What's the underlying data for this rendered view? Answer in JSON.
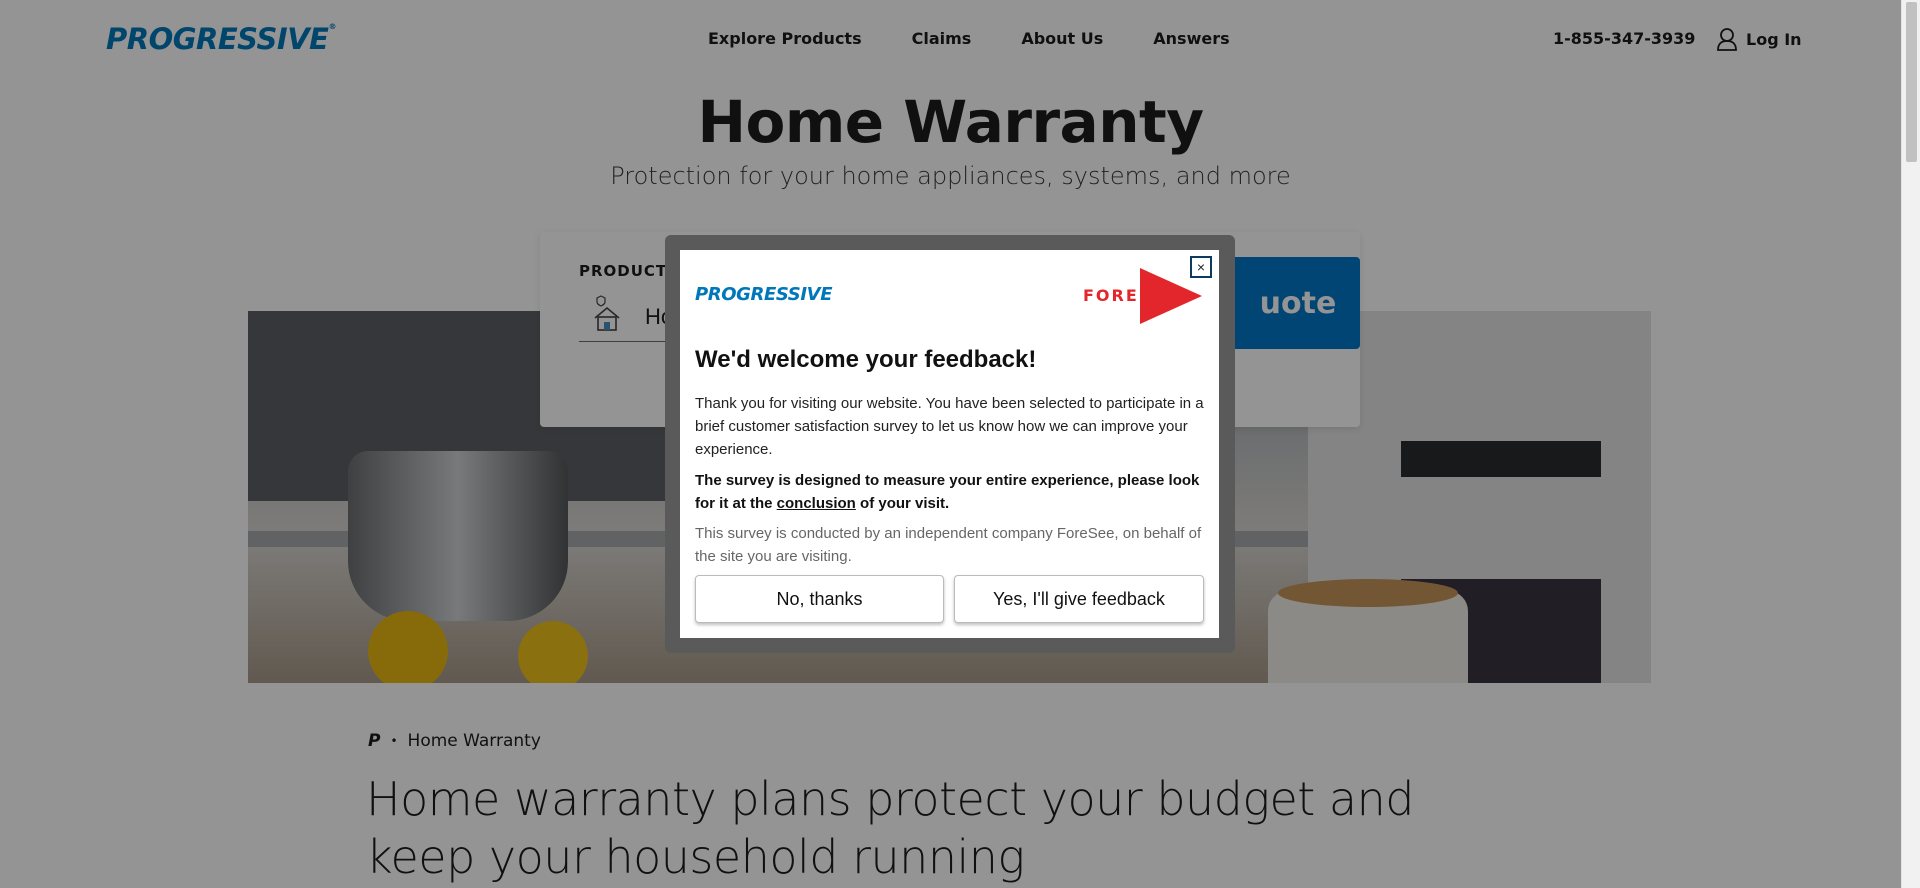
{
  "header": {
    "logo": "PROGRESSIVE",
    "nav": [
      "Explore Products",
      "Claims",
      "About Us",
      "Answers"
    ],
    "phone": "1-855-347-3939",
    "login": "Log In"
  },
  "hero": {
    "title": "Home Warranty",
    "subtitle": "Protection for your home appliances, systems, and more"
  },
  "quote": {
    "label": "PRODUCT",
    "field_value": "Hor",
    "button": "uote"
  },
  "breadcrumb": {
    "logo": "P",
    "current": "Home Warranty"
  },
  "content": {
    "heading": "Home warranty plans protect your budget and keep your household running"
  },
  "modal": {
    "logo": "PROGRESSIVE",
    "partner": "FORESEE",
    "close": "×",
    "title": "We'd welcome your feedback!",
    "p1": "Thank you for visiting our website. You have been selected to participate in a brief customer satisfaction survey to let us know how we can improve your experience.",
    "p2_a": "The survey is designed to measure your entire experience, please look for it at the ",
    "p2_link": "conclusion",
    "p2_b": " of your visit.",
    "p3": "This survey is conducted by an independent company ForeSee, on behalf of the site you are visiting.",
    "no_button": "No, thanks",
    "yes_button": "Yes, I'll give feedback"
  },
  "colors": {
    "brand_blue": "#0077bb",
    "foresee_red": "#e3262b",
    "overlay": "rgba(0,0,0,0.42)"
  }
}
